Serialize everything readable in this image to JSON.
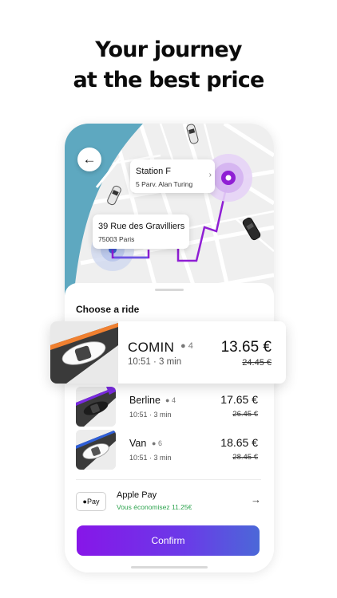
{
  "headline": {
    "line1": "Your journey",
    "line2": "at the best price"
  },
  "map": {
    "back_icon": "back-arrow-icon",
    "destination": {
      "name": "Station F",
      "address": "5 Parv. Alan Turing"
    },
    "origin": {
      "name": "39 Rue des Gravilliers",
      "address": "75003 Paris"
    },
    "route_color": "#8f1ed4",
    "river_color": "#5ea8c0"
  },
  "sheet": {
    "title": "Choose a ride",
    "rides": [
      {
        "name": "COMIN",
        "seats": "4",
        "time": "10:51",
        "duration": "3 min",
        "meta": "10:51 · 3 min",
        "price": "13.65 €",
        "old_price": "24.45 €",
        "accent": "#f08030",
        "selected": true
      },
      {
        "name": "Berline",
        "seats": "4",
        "meta": "10:51 · 3 min",
        "price": "17.65 €",
        "old_price": "26.45 €",
        "accent": "#7a2be0"
      },
      {
        "name": "Van",
        "seats": "6",
        "meta": "10:51 · 3 min",
        "price": "18.65 €",
        "old_price": "28.45 €",
        "accent": "#2f5fd8"
      }
    ],
    "payment": {
      "badge": " Pay",
      "method": "Apple Pay",
      "savings": "Vous économisez 11.25€"
    },
    "confirm_label": "Confirm"
  }
}
